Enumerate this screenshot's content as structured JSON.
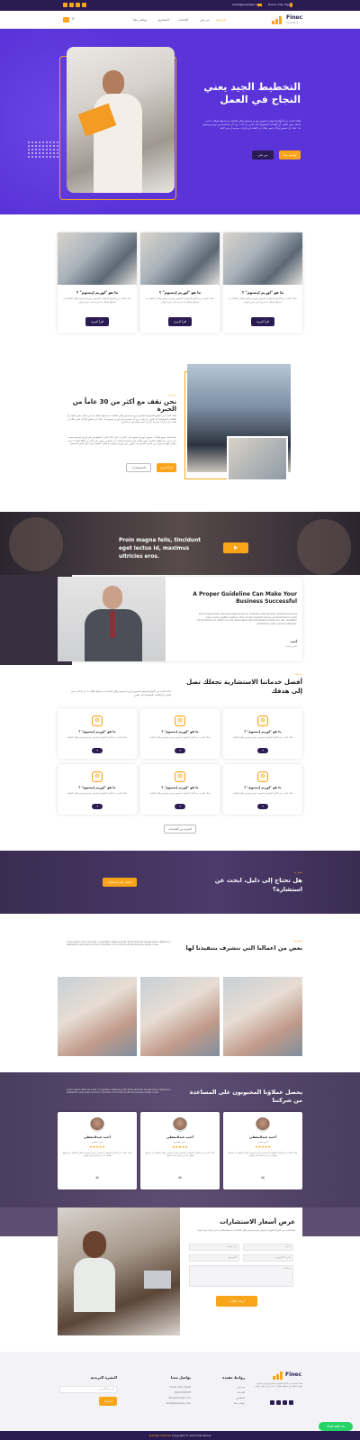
{
  "topbar": {
    "address": "Home, City, Egypt",
    "email": "email@example.com"
  },
  "header": {
    "logo_name": "Finec",
    "logo_tag": "Consulting",
    "nav": [
      "الرئيسية",
      "من نحن",
      "الخدمات",
      "المشاريع",
      "تواصل معنا"
    ],
    "active_nav": 0
  },
  "hero": {
    "title": "التخطيط الجيد يعني النجاح في العمل",
    "desc": "هناك العديد من الأنواع المتوفرة لنصوص لوريم إيبسوم ولكن الغالبية تم تعديلها بشكل ما عبر إدخال بعض النوادر أو الكلمات العشوائية إلى النص. إن كنت تريد أن تستخدم نص لوريم إيبسوم ما، عليك أن تتحقق أولاً أن ليس هناك أي كلمات أو عبارات محرجة أو غير لائقة",
    "btn_primary": "تواصل معنا",
    "btn_secondary": "من نحن"
  },
  "features": [
    {
      "title": "ما هو \"لوريم إيبسوم\" ؟",
      "desc": "هناك العديد من الأنواع المتوفرة لنصوص لوريم إيبسوم ولكن الغالبية تم تعديلها بشكل ما عبر إدخال بعض النوادر",
      "btn": "اقرأ المزيد"
    },
    {
      "title": "ما هو \"لوريم إيبسوم\" ؟",
      "desc": "هناك العديد من الأنواع المتوفرة لنصوص لوريم إيبسوم ولكن الغالبية تم تعديلها بشكل ما عبر إدخال بعض النوادر",
      "btn": "اقرأ المزيد"
    },
    {
      "title": "ما هو \"لوريم إيبسوم\" ؟",
      "desc": "هناك العديد من الأنواع المتوفرة لنصوص لوريم إيبسوم ولكن الغالبية تم تعديلها بشكل ما عبر إدخال بعض النوادر",
      "btn": "اقرأ المزيد"
    }
  ],
  "about": {
    "tag": "من نحن",
    "title": "نحن نقف مع أكثر من 30 عاماً من الخبرة",
    "p1": "هناك العديد من الأنواع المتوفرة لنصوص لوريم إيبسوم ولكن الغالبية تم تعديلها بشكل ما عبر إدخال بعض النوادر أو الكلمات العشوائية إلى النص. إن كنت تريد أن تستخدم نص لوريم إيبسوم ما، عليك أن تتحقق أولاً أن ليس هناك أي كلمات أو عبارات محرجة أو غير لائقة مخبأة في هذا النص.",
    "p2": "بينما تعمل جميع مولّدات نصوص لوريم إيبسوم على الإنترنت على إعادة تكرار مقاطع من نص لوريم إيبسوم نفسه عدة مرات بما تتطلبه الحاجة، يقوم مولّدنا هذا باستخدام كلمات من قاموس يحوي على أكثر من 200 كلمة لا تينية، مضاف إليها مجموعة من الجمل النموذجية، لتكوين نص لوريم إيبسوم ذو شكل منطقي قريب إلى النص الحقيقي.",
    "btn_primary": "اقرأ المزيد",
    "btn_secondary": "الاستشارات"
  },
  "banner": {
    "text": "Proin magna felis, tincidunt eget lectus id, maximus ultricies eros."
  },
  "guide": {
    "title": "A Proper Guideline Can Make Your Business Successful",
    "desc": "Proin magna felis, tincidunt eget lectus id, maximus ultricies eros. Aliquam eu lacus vitae lorem sagittis pretium. Proin porta molestie lectus, vel fermentum lorem condimentum ac. Nulla nec nisl vitae ligula vehicula semper mollis non nisi. Curabitur sollicitudin justo a porta interdum.",
    "name": "أحمد",
    "role": "المدير العام"
  },
  "services": {
    "tag": "خدماتنا",
    "title": "أفضل خدماتنا الاستشارية تجعلك تصل إلى هدفك",
    "desc": "هناك العديد من الأنواع المتوفرة لنصوص لوريم إيبسوم ولكن الغالبية تم تعديلها بشكل ما عبر إدخال بعض النوادر أو الكلمات العشوائية إلى النص.",
    "items": [
      {
        "title": "ما هو \"لوريم إيبسوم\" ؟",
        "desc": "هناك العديد من الأنواع المتوفرة لنصوص لوريم إيبسوم ولكن الغالبية"
      },
      {
        "title": "ما هو \"لوريم إيبسوم\" ؟",
        "desc": "هناك العديد من الأنواع المتوفرة لنصوص لوريم إيبسوم ولكن الغالبية"
      },
      {
        "title": "ما هو \"لوريم إيبسوم\" ؟",
        "desc": "هناك العديد من الأنواع المتوفرة لنصوص لوريم إيبسوم ولكن الغالبية"
      },
      {
        "title": "ما هو \"لوريم إيبسوم\" ؟",
        "desc": "هناك العديد من الأنواع المتوفرة لنصوص لوريم إيبسوم ولكن الغالبية"
      },
      {
        "title": "ما هو \"لوريم إيبسوم\" ؟",
        "desc": "هناك العديد من الأنواع المتوفرة لنصوص لوريم إيبسوم ولكن الغالبية"
      },
      {
        "title": "ما هو \"لوريم إيبسوم\" ؟",
        "desc": "هناك العديد من الأنواع المتوفرة لنصوص لوريم إيبسوم ولكن الغالبية"
      }
    ],
    "more_btn": "المزيد من الخدمات"
  },
  "cta": {
    "tag": "اتصل بنا",
    "title": "هل تحتاج إلى دليل، ابحث عن استشارة؟",
    "btn": "احصل على استشارة"
  },
  "projects": {
    "tag": "مشاريعنا",
    "title": "بعض من اعمالنا التي نتشرف بتنفيذنا لها",
    "desc": "Lorem ipsum dolor sit amet, consectetur adipiscing elit. Morbi pharetra laoreet lectus dapibus in. Vestibulum ante ipsum primis in faucibus orci luctus et ultrices posuere cubilia curae."
  },
  "testimonials": {
    "title": "يحصل عملاؤنا المحبوبون على المساعدة من شركتنا",
    "desc": "Lorem ipsum dolor sit amet, consectetur adipiscing elit. Morbi pharetra laoreet lectus dapibus in. Vestibulum ante ipsum primis in faucibus orci luctus et ultrices posuere cubilia curae.",
    "items": [
      {
        "name": "أحمد عبدالمعطي",
        "role": "مدير تنفيذي",
        "text": "هناك العديد من الأنواع المتوفرة لنصوص لوريم إيبسوم ولكن الغالبية تم تعديلها بشكل ما عبر إدخال بعض النوادر",
        "rating": 5
      },
      {
        "name": "أحمد عبدالمعطي",
        "role": "مدير تنفيذي",
        "text": "هناك العديد من الأنواع المتوفرة لنصوص لوريم إيبسوم ولكن الغالبية تم تعديلها بشكل ما عبر إدخال بعض النوادر",
        "rating": 5
      },
      {
        "name": "أحمد عبدالمعطي",
        "role": "مدير تنفيذي",
        "text": "هناك العديد من الأنواع المتوفرة لنصوص لوريم إيبسوم ولكن الغالبية تم تعديلها بشكل ما عبر إدخال بعض النوادر",
        "rating": 5
      }
    ]
  },
  "quote": {
    "title": "عرض أسعار الاستشارات",
    "desc": "هناك العديد من الأنواع المتوفرة لنصوص لوريم إيبسوم ولكن الغالبية تم تعديلها بشكل ما عبر إدخال بعض النوادر",
    "fields": [
      "الاسم",
      "البريد الإلكتروني",
      "رقم الهاتف",
      "الموضوع"
    ],
    "message": "رسالتك",
    "btn": "أرسل الطلب"
  },
  "footer": {
    "logo_name": "Finec",
    "about": "هناك العديد من الأنواع المتوفرة لنصوص لوريم إيبسوم ولكن الغالبية تم تعديلها بشكل ما عبر إدخال بعض النوادر",
    "links_title": "روابط مفيدة",
    "links": [
      "من نحن",
      "الخدمات",
      "المشاريع",
      "تواصل معنا"
    ],
    "contact_title": "تواصل معنا",
    "contact": [
      "Home, City, Egypt",
      "01012345678",
      "info@example.com",
      "email@example.com"
    ],
    "news_title": "النشرة البريدية",
    "news_placeholder": "البريد الإلكتروني",
    "news_btn": "اشترك"
  },
  "copyright": {
    "link": "Al3arab Themes",
    "text": "Copyright © 2023 Site Name"
  },
  "chat": {
    "label": "Chat with us"
  }
}
